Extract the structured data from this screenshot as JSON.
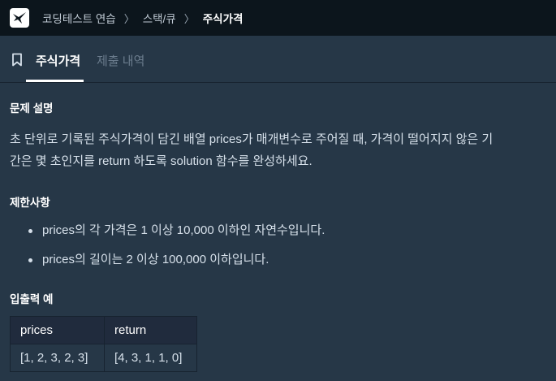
{
  "breadcrumb": {
    "items": [
      "코딩테스트 연습",
      "스택/큐"
    ],
    "current": "주식가격",
    "separator": "〉"
  },
  "tabs": {
    "active": "주식가격",
    "inactive": "제출 내역"
  },
  "problem": {
    "description_heading": "문제 설명",
    "description_line1": "초 단위로 기록된 주식가격이 담긴 배열 prices가 매개변수로 주어질 때, 가격이 떨어지지 않은 기",
    "description_line2": "간은 몇 초인지를 return 하도록 solution 함수를 완성하세요.",
    "constraints_heading": "제한사항",
    "constraints": [
      "prices의 각 가격은 1 이상 10,000 이하인 자연수입니다.",
      "prices의 길이는 2 이상 100,000 이하입니다."
    ],
    "examples_heading": "입출력 예",
    "examples_table": {
      "headers": [
        "prices",
        "return"
      ],
      "rows": [
        [
          "[1, 2, 3, 2, 3]",
          "[4, 3, 1, 1, 0]"
        ]
      ]
    }
  },
  "icons": {
    "logo": "programmers-logo-icon",
    "tab": "bookmark-icon"
  },
  "colors": {
    "topbar": "#0c151c",
    "background": "#263747",
    "table_header": "#202b3d",
    "text": "#d6e0ea",
    "muted": "#6b7c8d"
  }
}
